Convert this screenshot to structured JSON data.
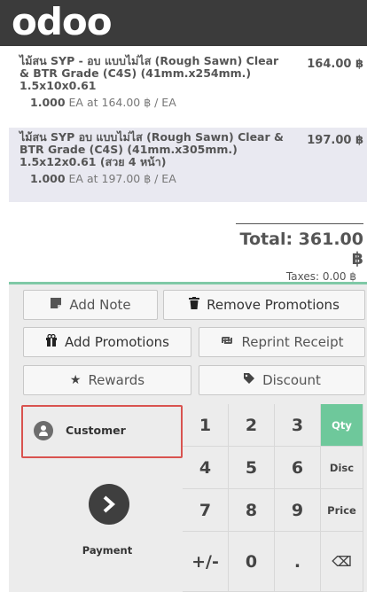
{
  "header": {
    "logo": "odoo"
  },
  "orderlines": [
    {
      "name": "ไม้สน SYP - อบ แบบไม่ไส (Rough Sawn) Clear & BTR Grade (C4S) (41mm.x254mm.) 1.5x10x0.61",
      "price": "164.00 ฿",
      "qty": "1.000",
      "unit_info": "EA at 164.00 ฿ / EA"
    },
    {
      "name": "ไม้สน SYP อบ แบบไม่ไส (Rough Sawn) Clear & BTR Grade (C4S) (41mm.x305mm.) 1.5x12x0.61 (สวย 4 หน้า)",
      "price": "197.00 ฿",
      "qty": "1.000",
      "unit_info": "EA at 197.00 ฿ / EA"
    }
  ],
  "summary": {
    "total": "Total: 361.00 ฿",
    "taxes": "Taxes: 0.00 ฿"
  },
  "controls": {
    "add_note": "Add Note",
    "remove_promotions": "Remove Promotions",
    "add_promotions": "Add Promotions",
    "reprint_receipt": "Reprint Receipt",
    "rewards": "Rewards",
    "discount": "Discount"
  },
  "customer": {
    "label": "Customer"
  },
  "payment": {
    "label": "Payment"
  },
  "keypad": {
    "k1": "1",
    "k2": "2",
    "k3": "3",
    "k4": "4",
    "k5": "5",
    "k6": "6",
    "k7": "7",
    "k8": "8",
    "k9": "9",
    "plusminus": "+/-",
    "k0": "0",
    "dot": ".",
    "qty": "Qty",
    "disc": "Disc",
    "price": "Price",
    "backspace": "⌫",
    "active_mode": "Qty"
  },
  "colors": {
    "accent": "#6ec89b",
    "highlight": "#d9534f",
    "header_bg": "#3b3b3b"
  },
  "icons": {
    "add_note": "note-icon",
    "remove_promotions": "trash-icon",
    "add_promotions": "gift-icon",
    "reprint_receipt": "retweet-icon",
    "rewards": "star-icon",
    "discount": "tag-icon",
    "customer": "user-icon",
    "payment": "chevron-right-icon",
    "backspace": "backspace-icon"
  }
}
